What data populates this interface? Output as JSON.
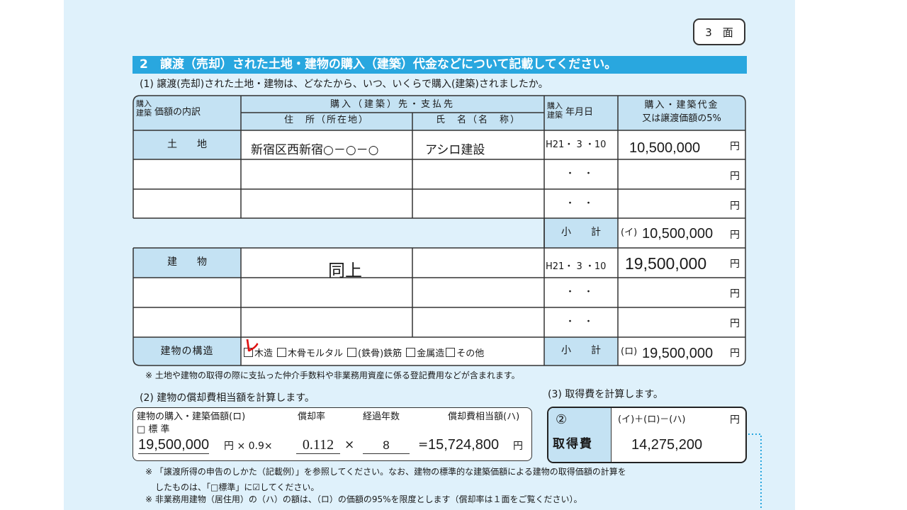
{
  "page_badge": "3　面",
  "section_title": "2　譲渡（売却）された土地・建物の購入（建築）代金などについて記載してください。",
  "q1_title": "(1) 譲渡(売却)された土地・建物は、どなたから、いつ、いくらで購入(建築)されましたか。",
  "headers": {
    "type_prefix": "購入\n建築",
    "type": "価額の内訳",
    "seller": "購入（建築）先・支払先",
    "address": "住　所（所在地）",
    "name": "氏　名（名　称）",
    "date_prefix": "購入\n建築",
    "date": "年月日",
    "price_line1": "購入・建築代金",
    "price_line2": "又は譲渡価額の5%"
  },
  "yen": "円",
  "dots": "・　・",
  "land": {
    "label": "土　　地",
    "address": "新宿区西新宿○－○－○",
    "name": "アシロ建設",
    "date": "H21・ 3 ・10",
    "price": "10,500,000"
  },
  "land_subtotal": {
    "label": "小　　計",
    "mark": "(イ)",
    "value": "10,500,000"
  },
  "building": {
    "label": "建　　物",
    "same": "同上",
    "date": "H21・ 3 ・10",
    "price": "19,500,000"
  },
  "structure": {
    "label": "建物の構造",
    "options": [
      "木造",
      "木骨モルタル",
      "(鉄骨)鉄筋",
      "金属造",
      "その他"
    ],
    "check_mark": "レ"
  },
  "building_subtotal": {
    "label": "小　　計",
    "mark": "(ロ)",
    "value": "19,500,000"
  },
  "note1": "※ 土地や建物の取得の際に支払った仲介手数料や非業務用資産に係る登記費用などが含まれます。",
  "q2_title": "(2) 建物の償却費相当額を計算します。",
  "q2": {
    "h1": "建物の購入・建築価額(ロ)",
    "h2": "償却率",
    "h3": "経過年数",
    "h4": "償却費相当額(ハ)",
    "standard": "□ 標 準",
    "price": "19,500,000",
    "yen_mult": "円 × 0.9×",
    "rate": "0.112",
    "times": "×",
    "years": "8",
    "eq": "=",
    "result": "15,724,800",
    "result_yen": "円"
  },
  "q3_title": "(3) 取得費を計算します。",
  "q3": {
    "num": "②",
    "label": "取得費",
    "formula": "(イ)＋(ロ)－(ハ)",
    "yen": "円",
    "value": "14,275,200"
  },
  "note2a": "※ 「譲渡所得の申告のしかた（記載例）」を参照してください。なお、建物の標準的な建築価額による建物の取得価額の計算を",
  "note2b": "したものは、「□標準」に☑してください。",
  "note3": "※ 非業務用建物（居住用）の（ハ）の額は、（ロ）の価額の95%を限度とします（償却率は１面をご覧ください）。"
}
